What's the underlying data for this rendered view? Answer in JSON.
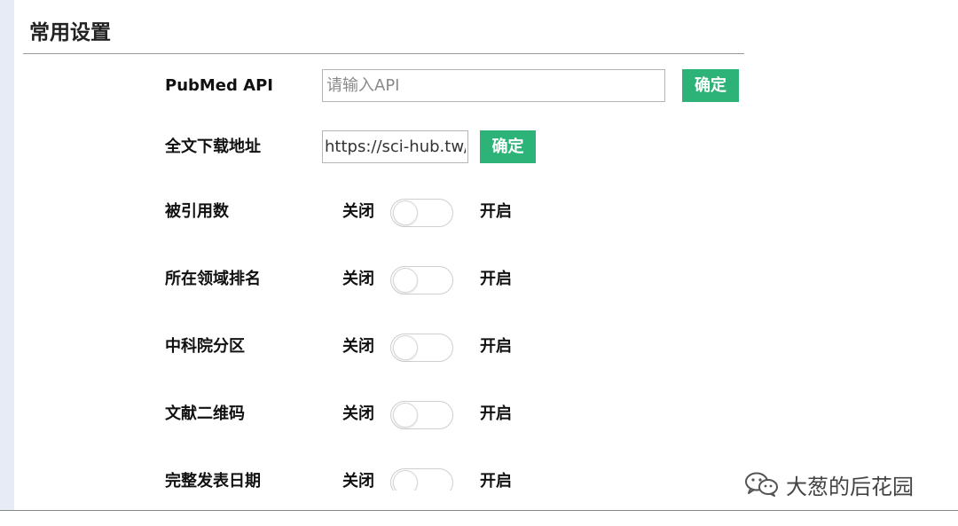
{
  "section_title": "常用设置",
  "api_row": {
    "label": "PubMed API",
    "placeholder": "请输入API",
    "confirm_label": "确定"
  },
  "download_row": {
    "label": "全文下载地址",
    "value": "https://sci-hub.tw/",
    "confirm_label": "确定"
  },
  "toggle_off_label": "关闭",
  "toggle_on_label": "开启",
  "toggles": [
    {
      "label": "被引用数",
      "state": "off"
    },
    {
      "label": "所在领域排名",
      "state": "off"
    },
    {
      "label": "中科院分区",
      "state": "off"
    },
    {
      "label": "文献二维码",
      "state": "off"
    },
    {
      "label": "完整发表日期",
      "state": "off"
    }
  ],
  "watermark": "大葱的后花园",
  "colors": {
    "accent": "#2db377",
    "left_strip": "#e7ebf5"
  }
}
